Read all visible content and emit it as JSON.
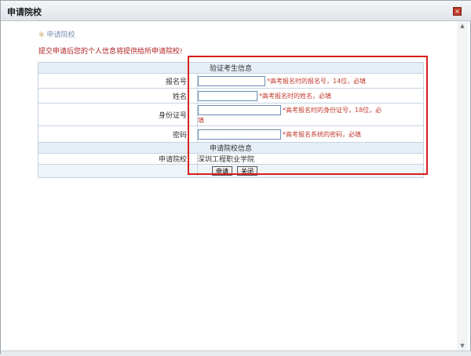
{
  "window": {
    "title": "申请院校",
    "close_glyph": "×"
  },
  "breadcrumb": {
    "star": "※",
    "label": "申请院校"
  },
  "prompt": "提交申请后您的个人信息将提供给所申请院校!",
  "verify_section_title": "验证考生信息",
  "fields": [
    {
      "label": "报名号：",
      "value": "",
      "hint": "*高考报名时的报名号，14位，必填"
    },
    {
      "label": "姓名：",
      "value": "",
      "hint": "*高考报名时的姓名，必填"
    },
    {
      "label": "身份证号：",
      "value": "",
      "hint": "*高考报名时的身份证号，18位，必",
      "hint_cont": "填"
    },
    {
      "label": "密码：",
      "value": "",
      "hint": "*高考报名系统的密码，必填"
    }
  ],
  "apply_section_title": "申请院校信息",
  "apply_row": {
    "label": "申请院校：",
    "value": "深圳工程职业学院"
  },
  "buttons": {
    "submit": "申请",
    "close": "关闭"
  },
  "scrollbar": {
    "up": "▲",
    "down": "▼"
  },
  "colors": {
    "highlight": "#d81e1e",
    "hint": "#c0392b",
    "band": "#e6eef7"
  }
}
